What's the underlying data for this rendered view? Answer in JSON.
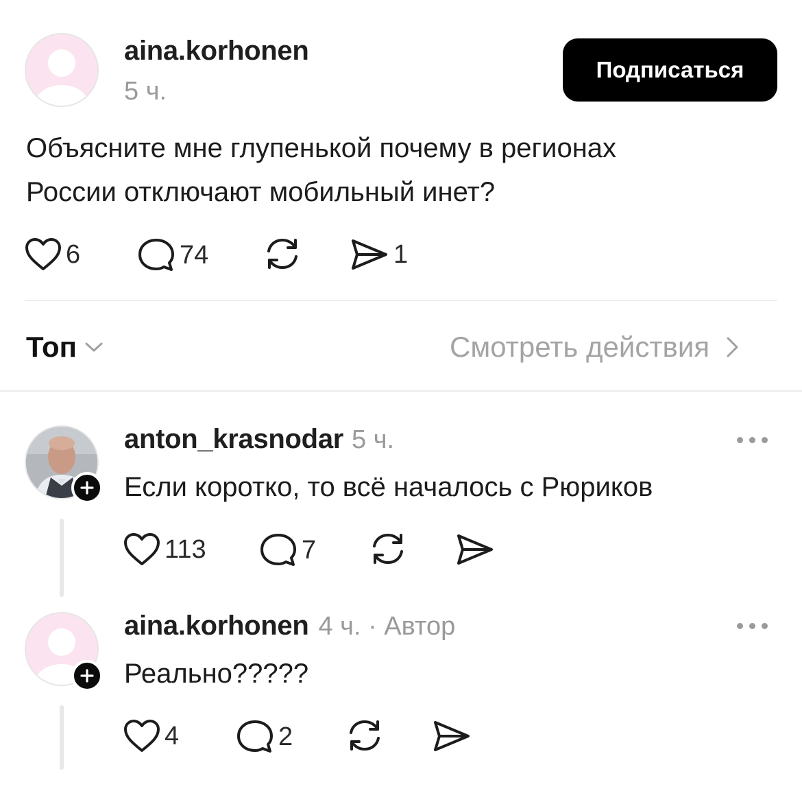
{
  "post": {
    "username": "aina.korhonen",
    "time": "5 ч.",
    "follow_label": "Подписаться",
    "text_line1": "Объясните мне глупенькой почему в регионах",
    "text_line2": "России отключают мобильный инет?",
    "likes": "6",
    "comments": "74",
    "shares": "1"
  },
  "sort": {
    "label": "Топ",
    "see_actions": "Смотреть действия"
  },
  "replies": [
    {
      "username": "anton_krasnodar",
      "time": "5 ч.",
      "text": "Если коротко, то всё началось с Рюриков",
      "likes": "113",
      "comments": "7"
    },
    {
      "username": "aina.korhonen",
      "time": "4 ч. · Автор",
      "text": "Реально?????",
      "likes": "4",
      "comments": "2"
    }
  ],
  "colors": {
    "button_bg": "#000000",
    "avatar_pink": "#fbe3ef",
    "muted_text": "#9a9a9a"
  },
  "icons": [
    "heart-icon",
    "comment-icon",
    "repost-icon",
    "send-icon",
    "chevron-down-icon",
    "chevron-right-icon",
    "more-icon",
    "plus-icon"
  ]
}
